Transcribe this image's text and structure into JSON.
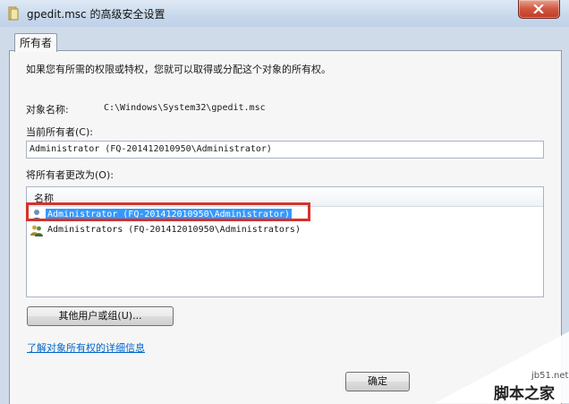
{
  "window": {
    "title": "gpedit.msc 的高级安全设置"
  },
  "tabs": [
    {
      "label": "所有者"
    }
  ],
  "panel": {
    "intro": "如果您有所需的权限或特权，您就可以取得或分配这个对象的所有权。",
    "object_name_label": "对象名称:",
    "object_name_value": "C:\\Windows\\System32\\gpedit.msc",
    "current_owner_label": "当前所有者(C):",
    "current_owner_value": "Administrator (FQ-201412010950\\Administrator)",
    "change_owner_label": "将所有者更改为(O):",
    "list": {
      "column_header": "名称",
      "rows": [
        {
          "label": "Administrator (FQ-201412010950\\Administrator)",
          "icon": "user-icon",
          "selected": true
        },
        {
          "label": "Administrators (FQ-201412010950\\Administrators)",
          "icon": "group-icon",
          "selected": false
        }
      ]
    },
    "other_users_button": "其他用户或组(U)...",
    "help_link": "了解对象所有权的详细信息",
    "ok_button": "确定"
  },
  "watermark": {
    "site": "jb51.net",
    "brand": "脚本之家"
  },
  "colors": {
    "selection": "#3399ff",
    "highlight_box": "#d7322a",
    "link": "#0066cc"
  }
}
